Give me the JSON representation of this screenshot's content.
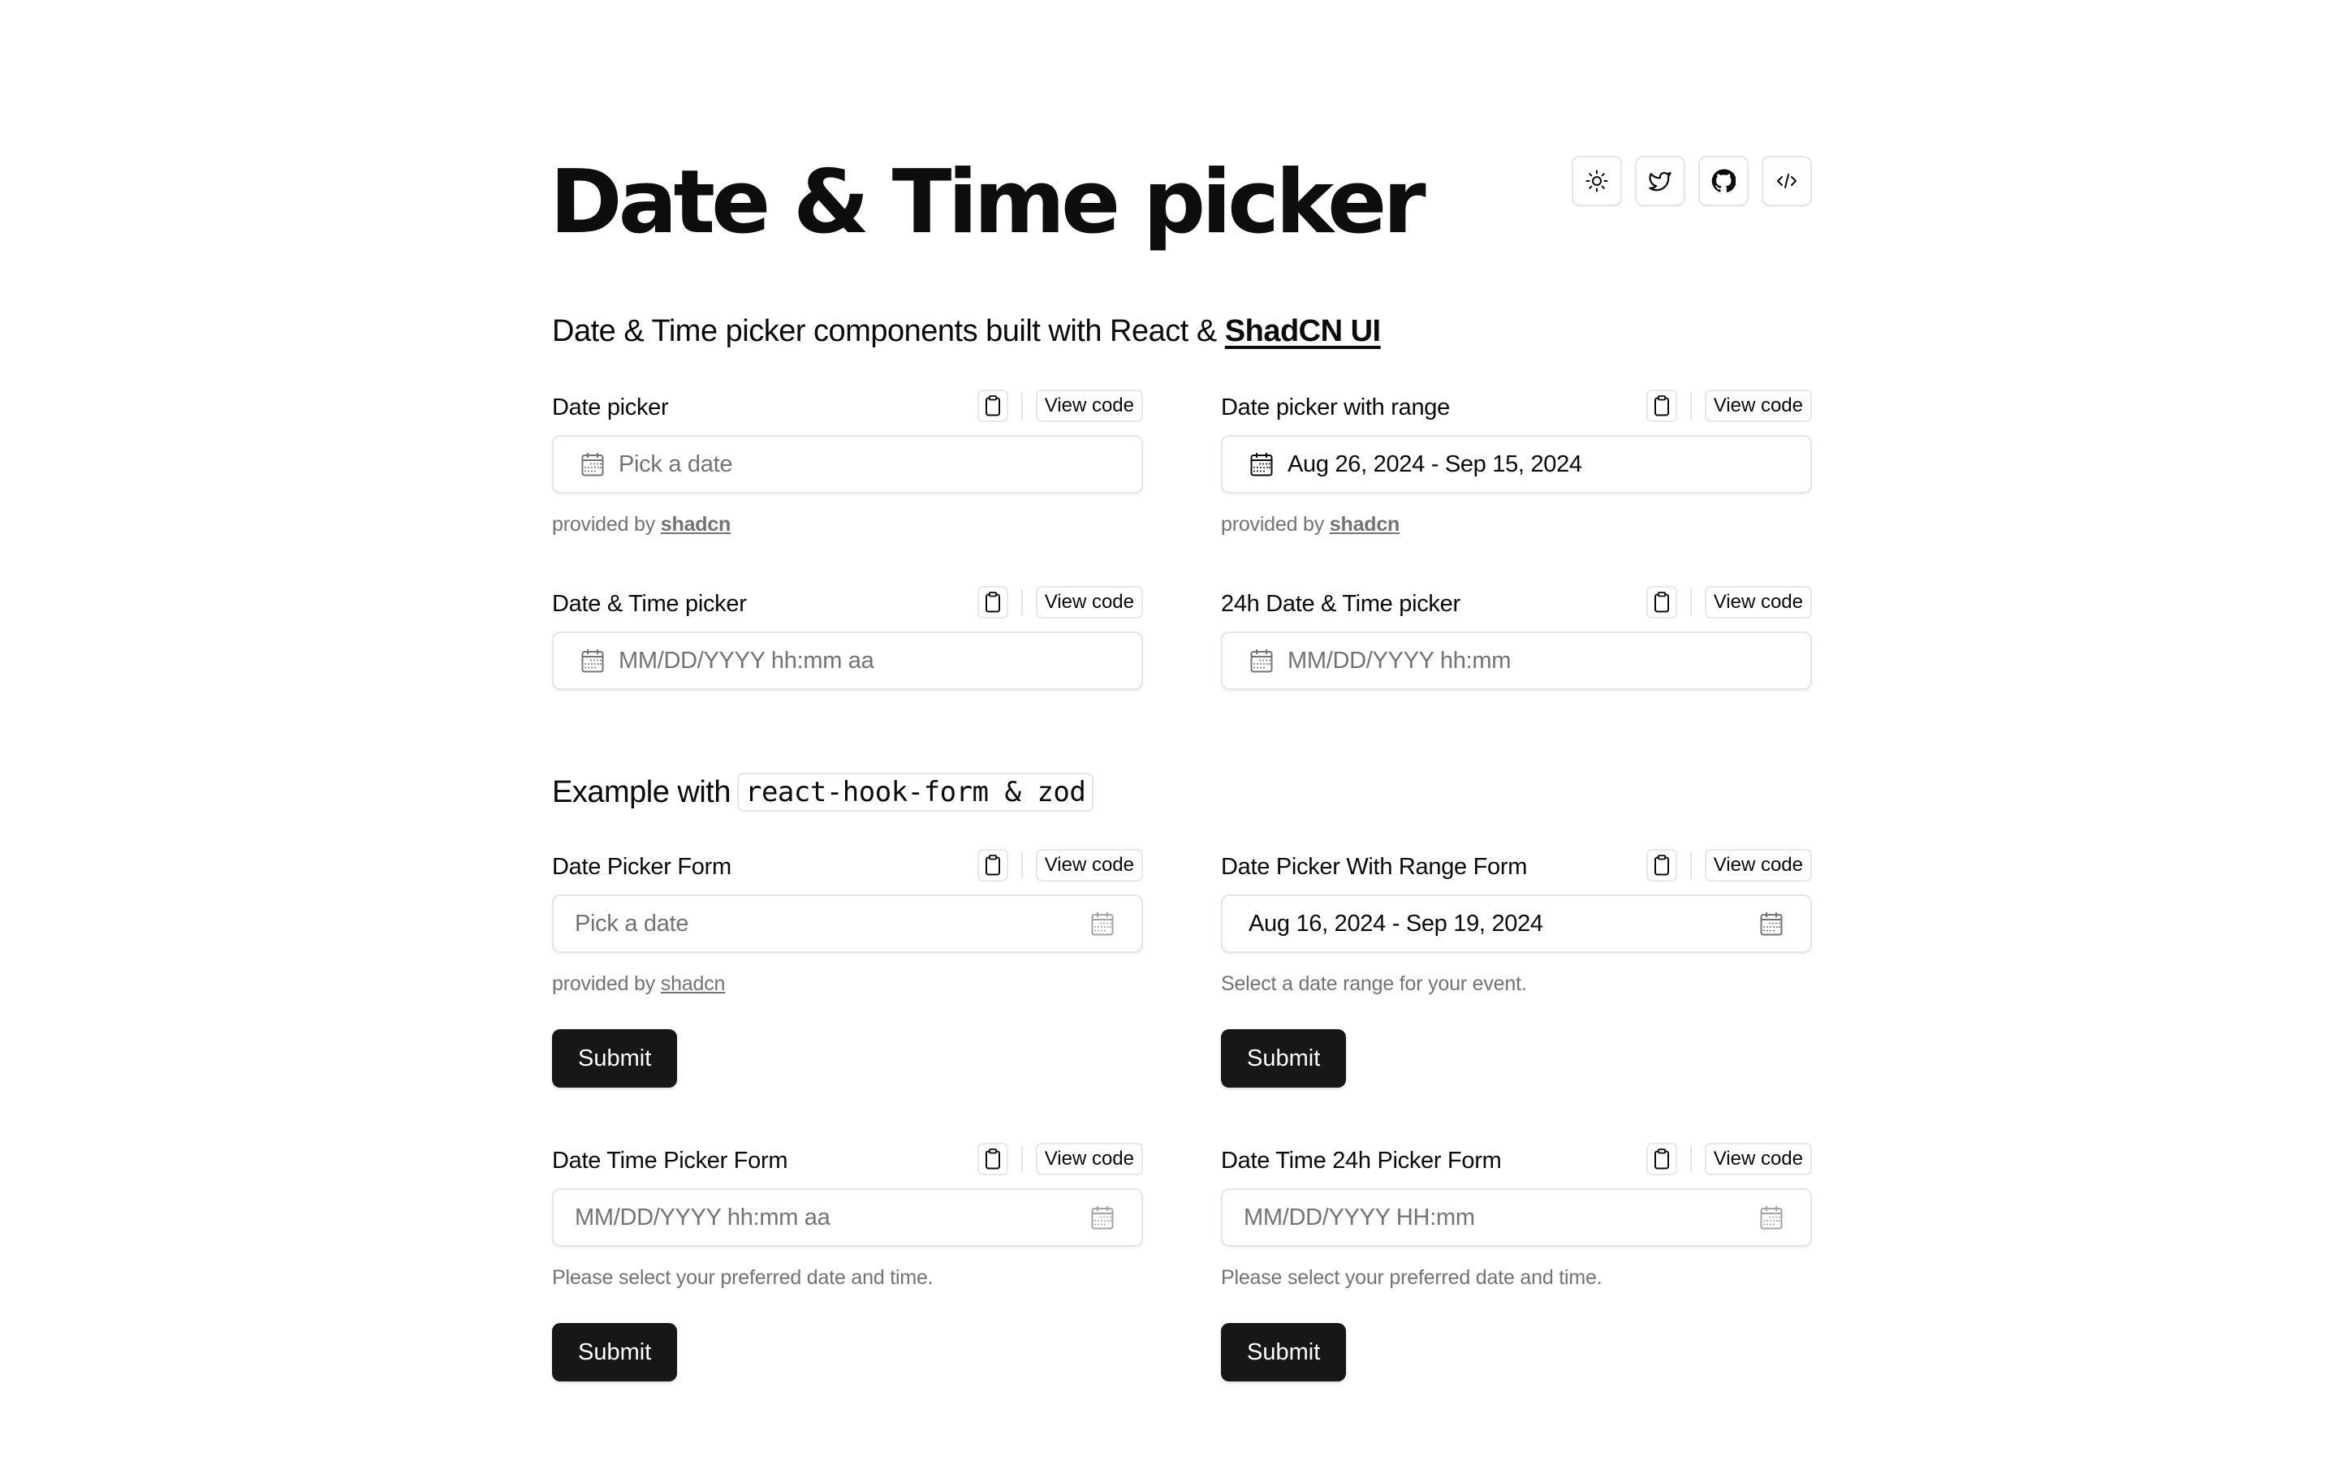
{
  "header": {
    "title": "Date & Time picker",
    "toolbar": [
      {
        "icon": "sun-icon",
        "label": "Toggle theme"
      },
      {
        "icon": "twitter-icon",
        "label": "Twitter"
      },
      {
        "icon": "github-icon",
        "label": "GitHub"
      },
      {
        "icon": "code-icon",
        "label": "Source code"
      }
    ]
  },
  "intro": {
    "text": "Date & Time picker components built with React & ",
    "link": "ShadCN UI"
  },
  "section2": {
    "prefix": "Example with",
    "code": "react-hook-form & zod"
  },
  "common": {
    "view_code": "View code",
    "provided_by": "provided by ",
    "shadcn_link": "shadcn",
    "submit": "Submit"
  },
  "cards": [
    {
      "title": "Date picker",
      "value": "",
      "placeholder": "Pick a date",
      "helper": "provided by",
      "helper_link": "shadcn"
    },
    {
      "title": "Date picker with range",
      "value": "Aug 26, 2024 - Sep 15, 2024",
      "placeholder": "",
      "helper": "provided by",
      "helper_link": "shadcn"
    },
    {
      "title": "Date & Time picker",
      "value": "",
      "placeholder": "MM/DD/YYYY hh:mm aa"
    },
    {
      "title": "24h Date & Time picker",
      "value": "",
      "placeholder": "MM/DD/YYYY hh:mm"
    }
  ],
  "forms": [
    {
      "title": "Date Picker Form",
      "value": "",
      "placeholder": "Pick a date",
      "helper": "provided by",
      "helper_link": "shadcn",
      "submit": "Submit"
    },
    {
      "title": "Date Picker With Range Form",
      "value": "Aug 16, 2024 - Sep 19, 2024",
      "placeholder": "",
      "helper": "Select a date range for your event.",
      "submit": "Submit"
    },
    {
      "title": "Date Time Picker Form",
      "value": "",
      "placeholder": "MM/DD/YYYY hh:mm aa",
      "helper": "Please select your preferred date and time.",
      "submit": "Submit"
    },
    {
      "title": "Date Time 24h Picker Form",
      "value": "",
      "placeholder": "MM/DD/YYYY HH:mm",
      "helper": "Please select your preferred date and time.",
      "submit": "Submit"
    }
  ],
  "colors": {
    "primary": "#171717",
    "muted_text": "#737373",
    "border": "#e5e5e5",
    "background": "#ffffff"
  }
}
